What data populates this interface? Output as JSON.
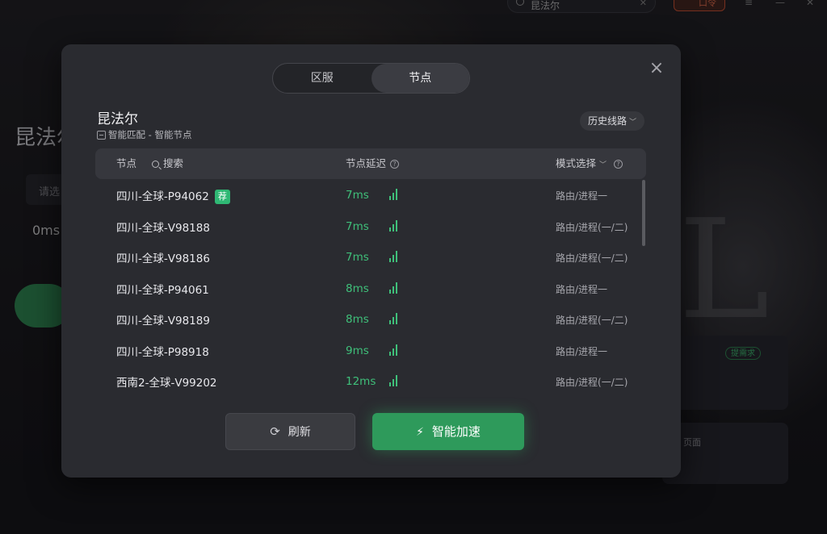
{
  "background": {
    "search_text": "昆法尔",
    "badge_text": "口令",
    "app_title": "昆法尔",
    "input_placeholder": "请选",
    "stat": "0ms",
    "card_tag": "提需求",
    "card2_text": "页面"
  },
  "modal": {
    "tabs": [
      {
        "label": "区服",
        "active": false
      },
      {
        "label": "节点",
        "active": true
      }
    ],
    "close_label": "×",
    "game_title": "昆法尔",
    "subtitle": "智能匹配 - 智能节点",
    "history_label": "历史线路",
    "table": {
      "col_node": "节点",
      "search_label": "搜索",
      "col_latency": "节点延迟",
      "col_mode": "模式选择",
      "help": "?"
    },
    "rows": [
      {
        "name": "四川-全球-P94062",
        "recommended": true,
        "latency": "7ms",
        "mode": "路由/进程一"
      },
      {
        "name": "四川-全球-V98188",
        "recommended": false,
        "latency": "7ms",
        "mode": "路由/进程(一/二)"
      },
      {
        "name": "四川-全球-V98186",
        "recommended": false,
        "latency": "7ms",
        "mode": "路由/进程(一/二)"
      },
      {
        "name": "四川-全球-P94061",
        "recommended": false,
        "latency": "8ms",
        "mode": "路由/进程一"
      },
      {
        "name": "四川-全球-V98189",
        "recommended": false,
        "latency": "8ms",
        "mode": "路由/进程(一/二)"
      },
      {
        "name": "四川-全球-P98918",
        "recommended": false,
        "latency": "9ms",
        "mode": "路由/进程一"
      },
      {
        "name": "西南2-全球-V99202",
        "recommended": false,
        "latency": "12ms",
        "mode": "路由/进程(一/二)"
      }
    ],
    "rec_badge": "荐",
    "refresh_label": "刷新",
    "accelerate_label": "智能加速",
    "accent_color": "#2e9a5b",
    "latency_color": "#3fc07a"
  }
}
